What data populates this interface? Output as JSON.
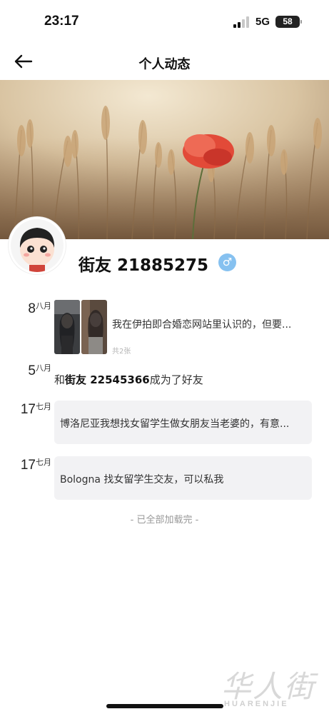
{
  "status_bar": {
    "time": "23:17",
    "network": "5G",
    "battery": "58"
  },
  "nav": {
    "title": "个人动态",
    "back_icon": "arrow-left-icon"
  },
  "profile": {
    "nickname": "街友 21885275",
    "gender_symbol": "♂",
    "gender_icon": "male-icon",
    "badge_color": "#86c1f0"
  },
  "feed": [
    {
      "day": "8",
      "month": "八月",
      "text": "我在伊拍即合婚恋网站里认识的，但要...",
      "photo_count": "共2张"
    },
    {
      "day": "5",
      "month": "八月",
      "prefix": "和",
      "friend": "街友 22545366",
      "suffix": "成为了好友"
    },
    {
      "day": "17",
      "month": "七月",
      "text": "博洛尼亚我想找女留学生做女朋友当老婆的，有意..."
    },
    {
      "day": "17",
      "month": "七月",
      "text": "Bologna 找女留学生交友，可以私我"
    }
  ],
  "footer": {
    "load_complete": "- 已全部加载完 -"
  },
  "watermark": {
    "cn": "华人街",
    "en": "HUARENJIE"
  }
}
